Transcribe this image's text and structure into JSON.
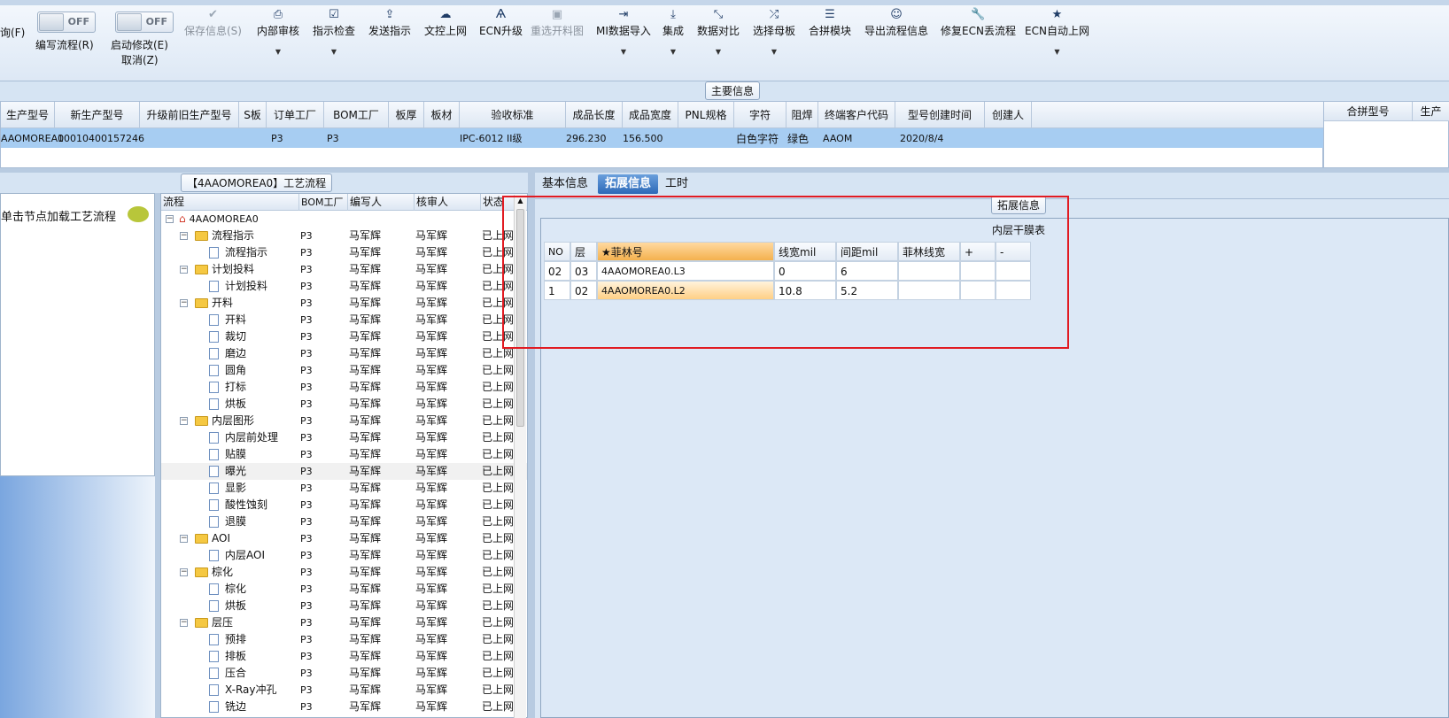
{
  "toolbar": {
    "partial_left": "询(F)",
    "toggle_off": "OFF",
    "edit_flow": "编写流程(R)",
    "start_modify": "启动修改(E)",
    "cancel": "取消(Z)",
    "buttons": [
      {
        "label": "保存信息(S)",
        "icon": "check-icon"
      },
      {
        "label": "内部审核",
        "icon": "print-icon"
      },
      {
        "label": "指示检查",
        "icon": "checklist-icon"
      },
      {
        "label": "发送指示",
        "icon": "upload-icon"
      },
      {
        "label": "文控上网",
        "icon": "cloud-upload-icon"
      },
      {
        "label": "ECN升级",
        "icon": "ecn-icon"
      },
      {
        "label": "重选开料图",
        "icon": "image-icon"
      },
      {
        "label": "MI数据导入",
        "icon": "import-icon"
      },
      {
        "label": "集成",
        "icon": "download-icon"
      },
      {
        "label": "数据对比",
        "icon": "compare-icon"
      },
      {
        "label": "选择母板",
        "icon": "shuffle-icon"
      },
      {
        "label": "合拼模块",
        "icon": "list-icon"
      },
      {
        "label": "导出流程信息",
        "icon": "smile-icon"
      },
      {
        "label": "修复ECN丢流程",
        "icon": "wrench-icon"
      },
      {
        "label": "ECN自动上网",
        "icon": "star-icon"
      }
    ]
  },
  "main_info": {
    "caption": "主要信息",
    "columns": [
      "生产型号",
      "新生产型号",
      "升级前旧生产型号",
      "S板",
      "订单工厂",
      "BOM工厂",
      "板厚",
      "板材",
      "验收标准",
      "成品长度",
      "成品宽度",
      "PNL规格",
      "字符",
      "阻焊",
      "终端客户代码",
      "型号创建时间",
      "创建人"
    ],
    "row": [
      "AAOMOREA0",
      "10010400157246",
      "",
      "",
      "P3",
      "P3",
      "",
      "",
      "IPC-6012 II级",
      "296.230",
      "156.500",
      "",
      "白色字符",
      "绿色",
      "AAOM",
      "2020/8/4",
      ""
    ]
  },
  "merge_pane": {
    "columns": [
      "合拼型号",
      "生产"
    ]
  },
  "left_pane": {
    "hint": "单击节点加载工艺流程"
  },
  "flow_caption": "【4AAOMOREA0】工艺流程",
  "tree": {
    "columns": [
      "流程",
      "BOM工厂",
      "编写人",
      "核审人",
      "状态"
    ],
    "rows": [
      {
        "level": 0,
        "type": "root",
        "name": "4AAOMOREA0",
        "bom": "",
        "writer": "",
        "reviewer": "",
        "status": ""
      },
      {
        "level": 1,
        "type": "folder",
        "name": "流程指示",
        "bom": "P3",
        "writer": "马军辉",
        "reviewer": "马军辉",
        "status": "已上网"
      },
      {
        "level": 2,
        "type": "doc",
        "name": "流程指示",
        "bom": "P3",
        "writer": "马军辉",
        "reviewer": "马军辉",
        "status": "已上网"
      },
      {
        "level": 1,
        "type": "folder",
        "name": "计划投料",
        "bom": "P3",
        "writer": "马军辉",
        "reviewer": "马军辉",
        "status": "已上网"
      },
      {
        "level": 2,
        "type": "doc",
        "name": "计划投料",
        "bom": "P3",
        "writer": "马军辉",
        "reviewer": "马军辉",
        "status": "已上网"
      },
      {
        "level": 1,
        "type": "folder",
        "name": "开料",
        "bom": "P3",
        "writer": "马军辉",
        "reviewer": "马军辉",
        "status": "已上网"
      },
      {
        "level": 2,
        "type": "doc",
        "name": "开料",
        "bom": "P3",
        "writer": "马军辉",
        "reviewer": "马军辉",
        "status": "已上网"
      },
      {
        "level": 2,
        "type": "doc",
        "name": "裁切",
        "bom": "P3",
        "writer": "马军辉",
        "reviewer": "马军辉",
        "status": "已上网"
      },
      {
        "level": 2,
        "type": "doc",
        "name": "磨边",
        "bom": "P3",
        "writer": "马军辉",
        "reviewer": "马军辉",
        "status": "已上网"
      },
      {
        "level": 2,
        "type": "doc",
        "name": "圆角",
        "bom": "P3",
        "writer": "马军辉",
        "reviewer": "马军辉",
        "status": "已上网"
      },
      {
        "level": 2,
        "type": "doc",
        "name": "打标",
        "bom": "P3",
        "writer": "马军辉",
        "reviewer": "马军辉",
        "status": "已上网"
      },
      {
        "level": 2,
        "type": "doc",
        "name": "烘板",
        "bom": "P3",
        "writer": "马军辉",
        "reviewer": "马军辉",
        "status": "已上网"
      },
      {
        "level": 1,
        "type": "folder",
        "name": "内层图形",
        "bom": "P3",
        "writer": "马军辉",
        "reviewer": "马军辉",
        "status": "已上网"
      },
      {
        "level": 2,
        "type": "doc",
        "name": "内层前处理",
        "bom": "P3",
        "writer": "马军辉",
        "reviewer": "马军辉",
        "status": "已上网"
      },
      {
        "level": 2,
        "type": "doc",
        "name": "贴膜",
        "bom": "P3",
        "writer": "马军辉",
        "reviewer": "马军辉",
        "status": "已上网"
      },
      {
        "level": 2,
        "type": "doc",
        "name": "曝光",
        "bom": "P3",
        "writer": "马军辉",
        "reviewer": "马军辉",
        "status": "已上网",
        "selected": true
      },
      {
        "level": 2,
        "type": "doc",
        "name": "显影",
        "bom": "P3",
        "writer": "马军辉",
        "reviewer": "马军辉",
        "status": "已上网"
      },
      {
        "level": 2,
        "type": "doc",
        "name": "酸性蚀刻",
        "bom": "P3",
        "writer": "马军辉",
        "reviewer": "马军辉",
        "status": "已上网"
      },
      {
        "level": 2,
        "type": "doc",
        "name": "退膜",
        "bom": "P3",
        "writer": "马军辉",
        "reviewer": "马军辉",
        "status": "已上网"
      },
      {
        "level": 1,
        "type": "folder",
        "name": "AOI",
        "bom": "P3",
        "writer": "马军辉",
        "reviewer": "马军辉",
        "status": "已上网"
      },
      {
        "level": 2,
        "type": "doc",
        "name": "内层AOI",
        "bom": "P3",
        "writer": "马军辉",
        "reviewer": "马军辉",
        "status": "已上网"
      },
      {
        "level": 1,
        "type": "folder",
        "name": "棕化",
        "bom": "P3",
        "writer": "马军辉",
        "reviewer": "马军辉",
        "status": "已上网"
      },
      {
        "level": 2,
        "type": "doc",
        "name": "棕化",
        "bom": "P3",
        "writer": "马军辉",
        "reviewer": "马军辉",
        "status": "已上网"
      },
      {
        "level": 2,
        "type": "doc",
        "name": "烘板",
        "bom": "P3",
        "writer": "马军辉",
        "reviewer": "马军辉",
        "status": "已上网"
      },
      {
        "level": 1,
        "type": "folder",
        "name": "层压",
        "bom": "P3",
        "writer": "马军辉",
        "reviewer": "马军辉",
        "status": "已上网"
      },
      {
        "level": 2,
        "type": "doc",
        "name": "预排",
        "bom": "P3",
        "writer": "马军辉",
        "reviewer": "马军辉",
        "status": "已上网"
      },
      {
        "level": 2,
        "type": "doc",
        "name": "排板",
        "bom": "P3",
        "writer": "马军辉",
        "reviewer": "马军辉",
        "status": "已上网"
      },
      {
        "level": 2,
        "type": "doc",
        "name": "压合",
        "bom": "P3",
        "writer": "马军辉",
        "reviewer": "马军辉",
        "status": "已上网"
      },
      {
        "level": 2,
        "type": "doc",
        "name": "X-Ray冲孔",
        "bom": "P3",
        "writer": "马军辉",
        "reviewer": "马军辉",
        "status": "已上网"
      },
      {
        "level": 2,
        "type": "doc",
        "name": "铣边",
        "bom": "P3",
        "writer": "马军辉",
        "reviewer": "马军辉",
        "status": "已上网"
      }
    ]
  },
  "detail_tabs": [
    "基本信息",
    "拓展信息",
    "工时"
  ],
  "ext_info": {
    "caption": "拓展信息",
    "table_title": "内层干膜表",
    "columns": [
      "NO",
      "层",
      "★菲林号",
      "线宽mil",
      "间距mil",
      "菲林线宽",
      "+",
      "-"
    ],
    "rows": [
      [
        "02",
        "03",
        "4AAOMOREA0.L3",
        "0",
        "6",
        "",
        "",
        ""
      ],
      [
        "1",
        "02",
        "4AAOMOREA0.L2",
        "10.8",
        "5.2",
        "",
        "",
        ""
      ]
    ]
  },
  "colors": {
    "accent": "#2c69b8",
    "highlight_row": "#a7cdf2",
    "callout": "#e11b22",
    "highlight_cell": "#ffcf85"
  }
}
